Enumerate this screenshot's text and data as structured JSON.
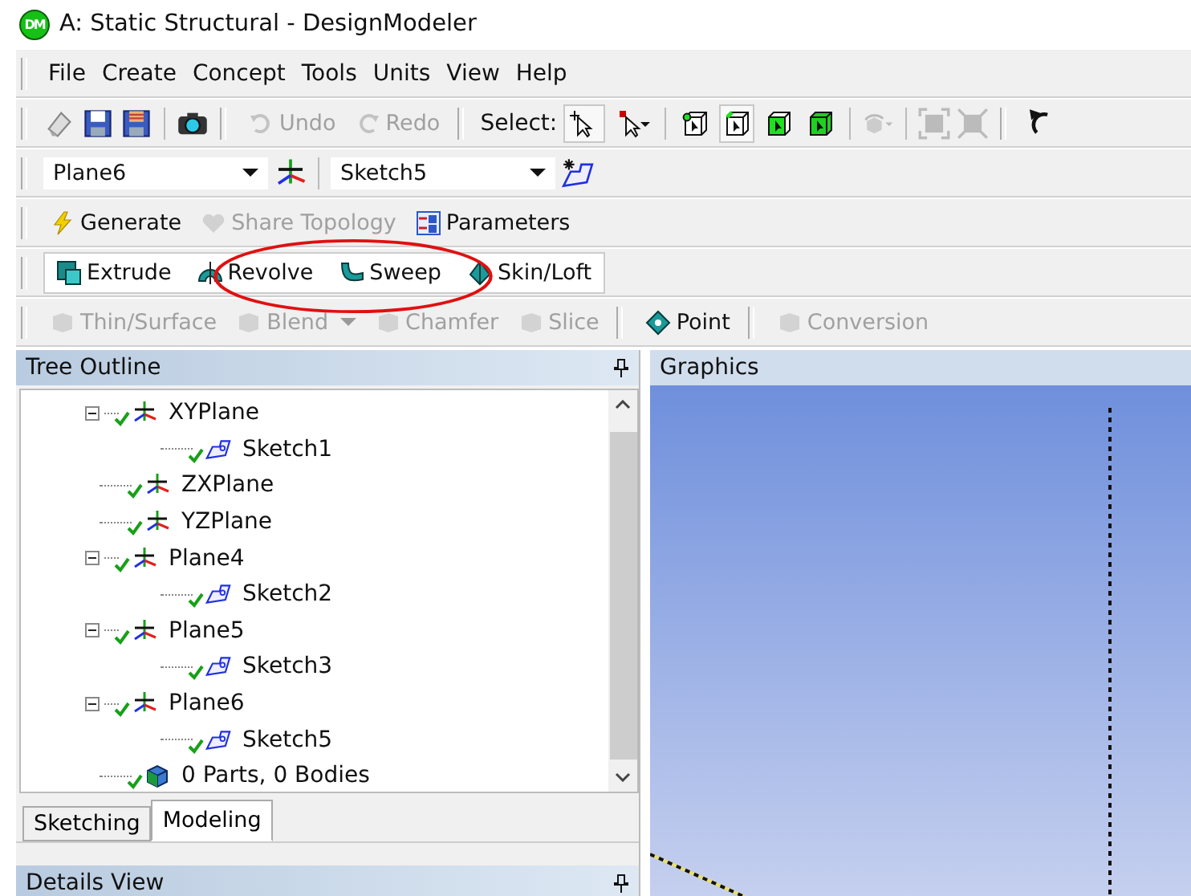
{
  "window": {
    "title": "A: Static Structural - DesignModeler",
    "logo": "DM"
  },
  "menu": [
    "File",
    "Create",
    "Concept",
    "Tools",
    "Units",
    "View",
    "Help"
  ],
  "standard_toolbar": {
    "undo": {
      "label": "Undo",
      "disabled": true
    },
    "redo": {
      "label": "Redo",
      "disabled": true
    },
    "select_label": "Select:",
    "select_modes": [
      {
        "kind": "single",
        "selected": true
      },
      {
        "kind": "mode",
        "selected": false
      }
    ],
    "filters": [
      {
        "kind": "point",
        "selected": false
      },
      {
        "kind": "edge",
        "selected": true
      },
      {
        "kind": "face",
        "selected": false
      },
      {
        "kind": "body",
        "selected": false
      }
    ]
  },
  "plane_toolbar": {
    "plane": "Plane6",
    "sketch": "Sketch5"
  },
  "feature_toolbar": [
    {
      "label": "Generate",
      "kind": "generate",
      "disabled": false
    },
    {
      "label": "Share Topology",
      "kind": "share",
      "disabled": true
    },
    {
      "label": "Parameters",
      "kind": "parameters",
      "disabled": false
    }
  ],
  "modeling_toolbar": [
    {
      "label": "Extrude",
      "kind": "extrude"
    },
    {
      "label": "Revolve",
      "kind": "revolve"
    },
    {
      "label": "Sweep",
      "kind": "sweep"
    },
    {
      "label": "Skin/Loft",
      "kind": "loft"
    }
  ],
  "modify_toolbar": [
    {
      "label": "Thin/Surface",
      "kind": "thin",
      "disabled": true,
      "dropdown": false
    },
    {
      "label": "Blend",
      "kind": "blend",
      "disabled": true,
      "dropdown": true
    },
    {
      "label": "Chamfer",
      "kind": "chamfer",
      "disabled": true,
      "dropdown": false
    },
    {
      "label": "Slice",
      "kind": "slice",
      "disabled": true,
      "dropdown": false
    },
    {
      "label": "Point",
      "kind": "point",
      "disabled": false,
      "dropdown": false
    },
    {
      "label": "Conversion",
      "kind": "conversion",
      "disabled": true,
      "dropdown": false
    }
  ],
  "tree_outline": {
    "title": "Tree Outline",
    "items": [
      {
        "label": "XYPlane",
        "kind": "plane",
        "expanded": true,
        "children": [
          {
            "label": "Sketch1",
            "kind": "sketch"
          }
        ]
      },
      {
        "label": "ZXPlane",
        "kind": "plane"
      },
      {
        "label": "YZPlane",
        "kind": "plane"
      },
      {
        "label": "Plane4",
        "kind": "plane",
        "expanded": true,
        "children": [
          {
            "label": "Sketch2",
            "kind": "sketch"
          }
        ]
      },
      {
        "label": "Plane5",
        "kind": "plane",
        "expanded": true,
        "children": [
          {
            "label": "Sketch3",
            "kind": "sketch"
          }
        ]
      },
      {
        "label": "Plane6",
        "kind": "plane",
        "expanded": true,
        "children": [
          {
            "label": "Sketch5",
            "kind": "sketch"
          }
        ]
      },
      {
        "label": "0 Parts, 0 Bodies",
        "kind": "parts"
      }
    ]
  },
  "tabs": [
    {
      "label": "Sketching",
      "selected": false
    },
    {
      "label": "Modeling",
      "selected": true
    }
  ],
  "details_view": {
    "title": "Details View"
  },
  "graphics": {
    "title": "Graphics"
  }
}
